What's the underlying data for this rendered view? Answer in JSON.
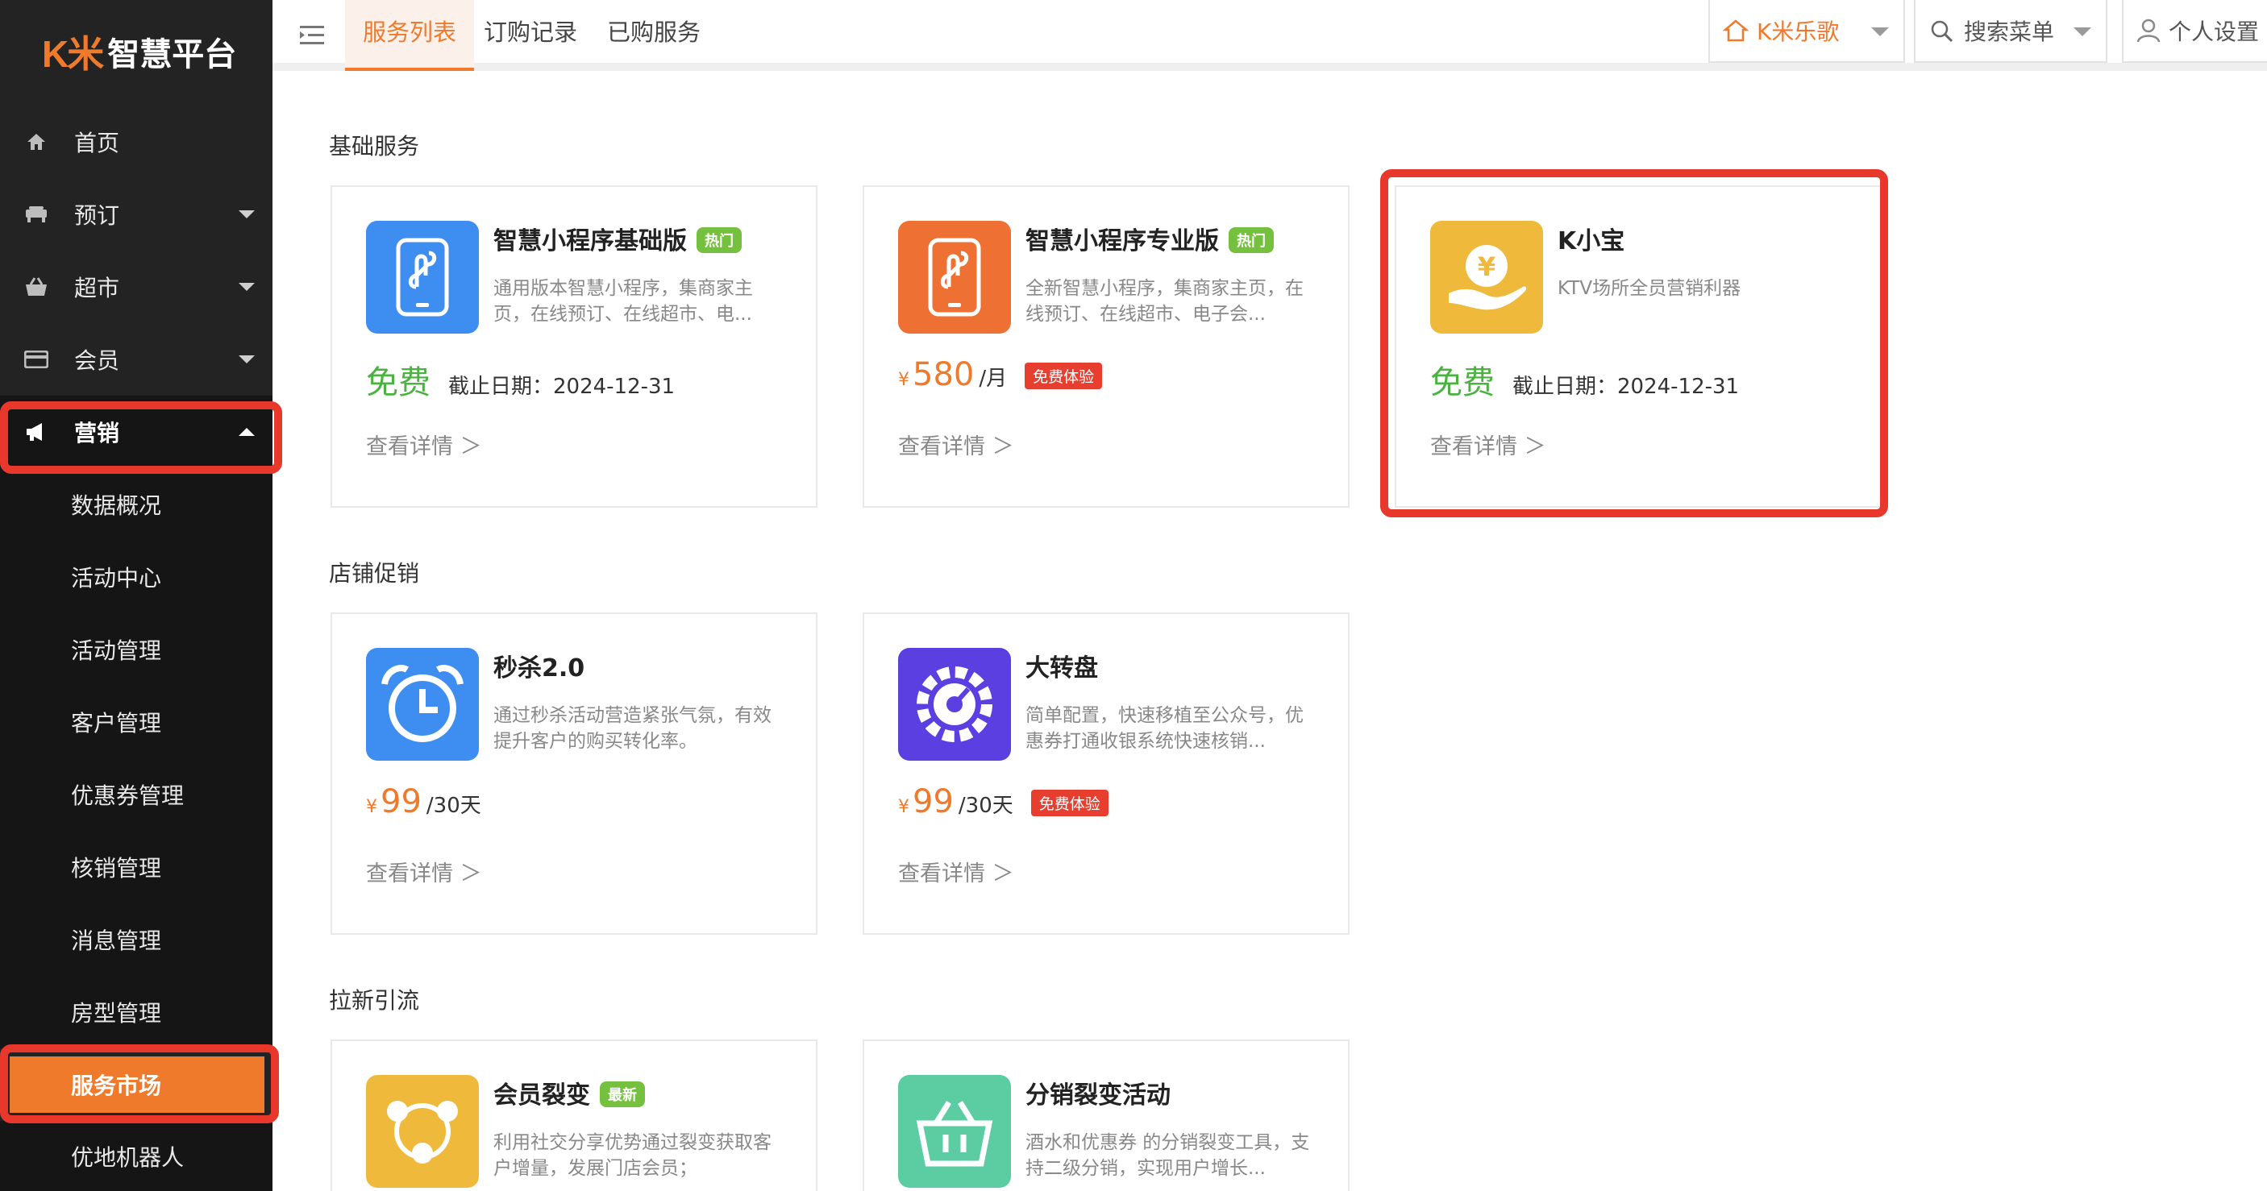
{
  "logo": {
    "mark": "K米",
    "title": "智慧平台"
  },
  "sidebar": {
    "items": [
      {
        "label": "首页",
        "icon": "home-icon"
      },
      {
        "label": "预订",
        "icon": "booking-icon"
      },
      {
        "label": "超市",
        "icon": "basket-icon"
      },
      {
        "label": "会员",
        "icon": "card-icon"
      },
      {
        "label": "营销",
        "icon": "megaphone-icon"
      }
    ],
    "marketing_children": [
      "数据概况",
      "活动中心",
      "活动管理",
      "客户管理",
      "优惠券管理",
      "核销管理",
      "消息管理",
      "房型管理",
      "服务市场",
      "优地机器人"
    ],
    "current": "服务市场"
  },
  "header": {
    "tabs": [
      "服务列表",
      "订购记录",
      "已购服务"
    ],
    "active_tab": "服务列表",
    "store_selector": "K米乐歌",
    "search_menu": "搜索菜单",
    "personal_settings": "个人设置"
  },
  "sections": [
    {
      "title": "基础服务",
      "cards": [
        {
          "name": "智慧小程序基础版",
          "badge": "热门",
          "desc": "通用版本智慧小程序，集商家主页，在线预订、在线超市、电...",
          "free": "免费",
          "deadline": "截止日期：2024-12-31",
          "detail": "查看详情 ＞",
          "icon": "mini-program-icon",
          "icon_color": "#3d8ef0"
        },
        {
          "name": "智慧小程序专业版",
          "badge": "热门",
          "desc": "全新智慧小程序，集商家主页，在线预订、在线超市、电子会...",
          "currency": "¥",
          "price": "580",
          "unit": "/月",
          "trial": "免费体验",
          "detail": "查看详情 ＞",
          "icon": "mini-program-icon",
          "icon_color": "#ee7033"
        },
        {
          "name": "K小宝",
          "desc": "KTV场所全员营销利器",
          "free": "免费",
          "deadline": "截止日期：2024-12-31",
          "detail": "查看详情 ＞",
          "icon": "coin-hand-icon",
          "icon_color": "#efba3c"
        }
      ]
    },
    {
      "title": "店铺促销",
      "cards": [
        {
          "name": "秒杀2.0",
          "desc": "通过秒杀活动营造紧张气氛，有效提升客户的购买转化率。",
          "currency": "¥",
          "price": "99",
          "unit": "/30天",
          "detail": "查看详情 ＞",
          "icon": "alarm-clock-icon",
          "icon_color": "#3d8ef0"
        },
        {
          "name": "大转盘",
          "desc": "简单配置，快速移植至公众号，优惠券打通收银系统快速核销...",
          "currency": "¥",
          "price": "99",
          "unit": "/30天",
          "trial": "免费体验",
          "detail": "查看详情 ＞",
          "icon": "wheel-icon",
          "icon_color": "#5b3fe0"
        }
      ]
    },
    {
      "title": "拉新引流",
      "cards": [
        {
          "name": "会员裂变",
          "badge": "最新",
          "desc": "利用社交分享优势通过裂变获取客户增量，发展门店会员；",
          "icon": "share-people-icon",
          "icon_color": "#efba3c"
        },
        {
          "name": "分销裂变活动",
          "desc": "酒水和优惠券 的分销裂变工具，支持二级分销，实现用户增长...",
          "icon": "basket-icon",
          "icon_color": "#5ccca3"
        }
      ]
    }
  ]
}
